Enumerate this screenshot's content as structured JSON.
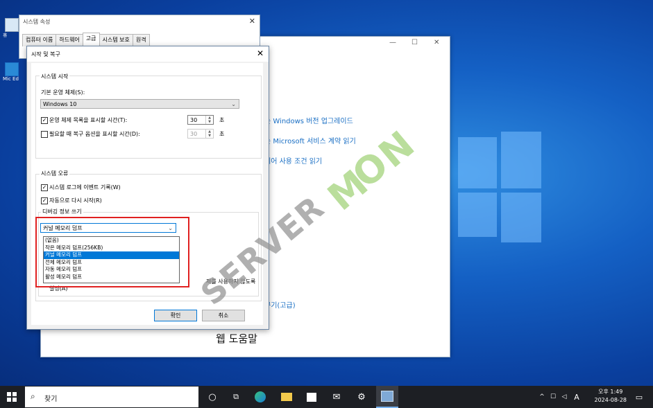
{
  "desktop": {
    "icons": [
      {
        "label": "휴"
      },
      {
        "label": "Mic Ed"
      }
    ]
  },
  "bg_window": {
    "links": [
      "는 Windows 버전 업그레이드",
      "는 Microsoft 서비스 계약 읽기",
      "웨어 사용 조건 읽기",
      "꾸기(고급)"
    ],
    "heading": "웹 도움말",
    "controls": [
      "—",
      "☐",
      "✕"
    ]
  },
  "system_properties": {
    "title": "시스템 속성",
    "tabs": [
      "컴퓨터 이름",
      "하드웨어",
      "고급",
      "시스템 보호",
      "원격"
    ],
    "active_tab": "고급"
  },
  "dialog": {
    "title": "시작 및 복구",
    "startup_group": "시스템 시작",
    "default_os_label": "기본 운영 체제(S):",
    "default_os_value": "Windows 10",
    "show_list_label": "운영 체제 목록을 표시할 시간(T):",
    "show_list_value": "30",
    "show_recovery_label": "필요할 때 복구 옵션을 표시할 시간(D):",
    "show_recovery_value": "30",
    "unit": "초",
    "failure_group": "시스템 오류",
    "write_event_label": "시스템 로그에 이벤트 기록(W)",
    "auto_restart_label": "자동으로 다시 시작(R)",
    "debug_group": "디버깅 정보 쓰기",
    "debug_selected": "커널 메모리 덤프",
    "debug_options": [
      "(없음)",
      "작은 메모리 덤프(256KB)",
      "커널 메모리 덤프",
      "전체 메모리 덤프",
      "자동 메모리 덤프",
      "활성 메모리 덤프"
    ],
    "debug_highlighted_index": 2,
    "disable_autodelete_partial": "제를 사용하지 않도록",
    "disable_autodelete_tail": "설정(A)",
    "ok_label": "확인",
    "cancel_label": "취소"
  },
  "watermark": {
    "text": "SERVER"
  },
  "taskbar": {
    "search_placeholder": "찾기",
    "clock_time": "오후 1:49",
    "clock_date": "2024-08-28",
    "ime": "A"
  },
  "colors": {
    "accent": "#0078d7",
    "highlight_box": "#e02020",
    "link": "#1a6fc4"
  }
}
